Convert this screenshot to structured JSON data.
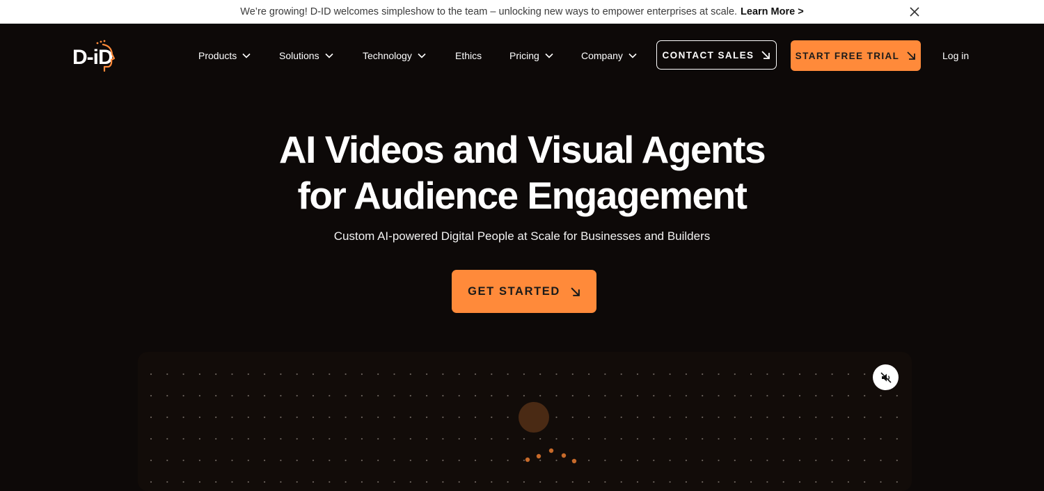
{
  "announcement": {
    "message": "We’re growing! D-ID welcomes simpleshow to the team –  unlocking new ways to empower enterprises at scale.",
    "link_label": "Learn More >",
    "close_icon": "close-icon"
  },
  "brand": {
    "logo_text": "D-iD",
    "accent_color": "#ff8a3a"
  },
  "nav": {
    "items": [
      {
        "label": "Products",
        "has_dropdown": true
      },
      {
        "label": "Solutions",
        "has_dropdown": true
      },
      {
        "label": "Technology",
        "has_dropdown": true
      },
      {
        "label": "Ethics",
        "has_dropdown": false
      },
      {
        "label": "Pricing",
        "has_dropdown": true
      },
      {
        "label": "Company",
        "has_dropdown": true
      }
    ],
    "contact_sales": "CONTACT SALES",
    "start_free_trial": "START FREE TRIAL",
    "login": "Log in"
  },
  "hero": {
    "title_line1": "AI Videos and Visual Agents",
    "title_line2": "for Audience Engagement",
    "subtitle": "Custom AI-powered Digital People at Scale for Businesses and Builders",
    "cta": "GET STARTED"
  },
  "video": {
    "mute_icon": "speaker-muted-icon"
  }
}
